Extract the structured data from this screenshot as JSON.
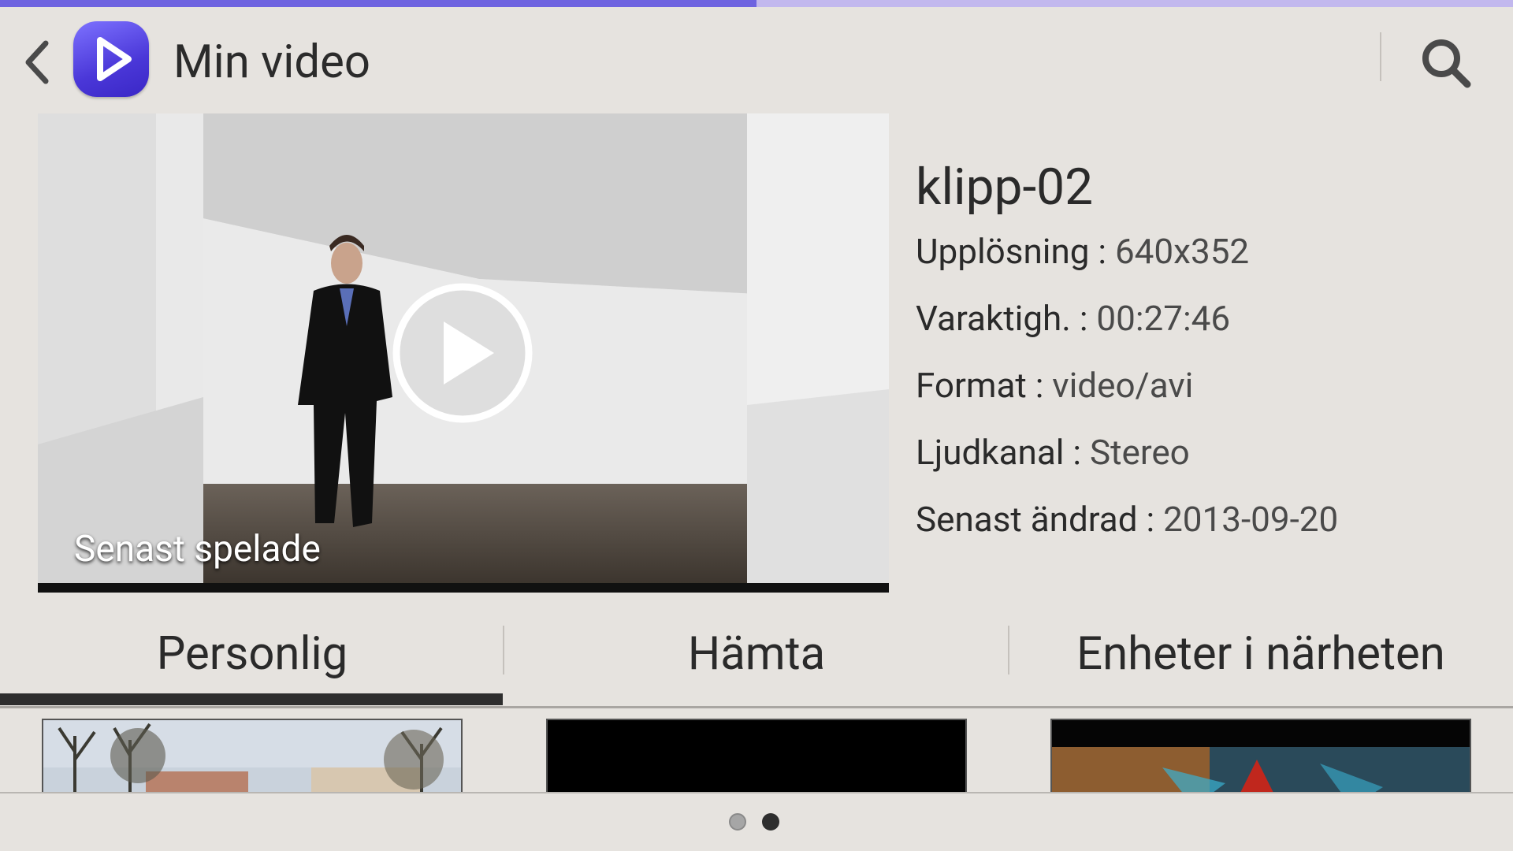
{
  "app": {
    "title": "Min video"
  },
  "progress": {
    "fraction": 0.5
  },
  "preview": {
    "label": "Senast spelade"
  },
  "info": {
    "title": "klipp-02",
    "rows": [
      {
        "label": "Upplösning",
        "sep": ":",
        "value": "640x352"
      },
      {
        "label": "Varaktigh.",
        "sep": ":",
        "value": "00:27:46"
      },
      {
        "label": "Format",
        "sep": ":",
        "value": "video/avi"
      },
      {
        "label": "Ljudkanal",
        "sep": ":",
        "value": "Stereo"
      },
      {
        "label": "Senast ändrad",
        "sep": ":",
        "value": "2013-09-20"
      }
    ]
  },
  "tabs": [
    {
      "label": "Personlig",
      "active": true
    },
    {
      "label": "Hämta",
      "active": false
    },
    {
      "label": "Enheter i närheten",
      "active": false
    }
  ],
  "pager": {
    "count": 2,
    "current": 2
  },
  "colors": {
    "accent": "#6e63e0",
    "progress_track": "#c2b8ee",
    "background": "#e6e3df",
    "indicator": "#2e2e2e"
  },
  "icons": {
    "back": "chevron-left-icon",
    "app": "play-app-icon",
    "search": "search-icon",
    "play": "play-circle-icon"
  }
}
